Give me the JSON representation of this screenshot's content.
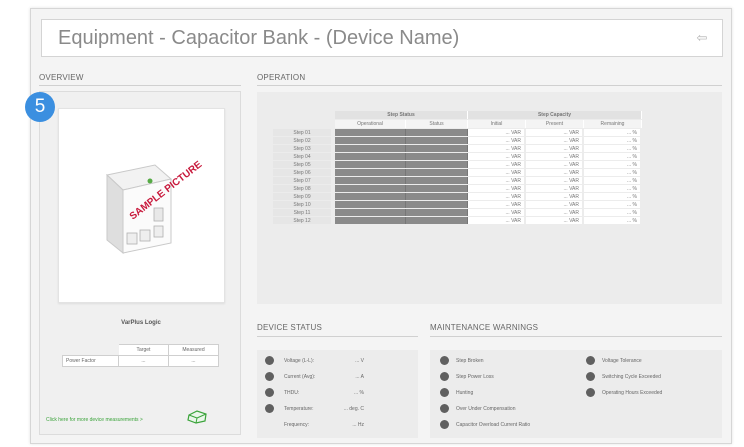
{
  "header": {
    "title": "Equipment - Capacitor Bank - (Device Name)",
    "back_icon": "exit-arrow-icon"
  },
  "badge": "5",
  "overview": {
    "title": "OVERVIEW",
    "picture_watermark": "SAMPLE PICTURE",
    "product_name": "VarPlus Logic",
    "pf_table": {
      "headers": [
        "Target",
        "Measured"
      ],
      "row_label": "Power Factor",
      "values": [
        "...",
        "..."
      ]
    },
    "more_link": "Click here for more device measurements >"
  },
  "operation": {
    "title": "OPERATION",
    "group_headers": [
      "Step Status",
      "Step Capacity"
    ],
    "sub_headers": [
      "Operational",
      "Status",
      "Initial",
      "Present",
      "Remaining"
    ],
    "rows": [
      {
        "label": "Step 01",
        "initial": "... VAR",
        "present": "... VAR",
        "remaining": "... %"
      },
      {
        "label": "Step 02",
        "initial": "... VAR",
        "present": "... VAR",
        "remaining": "... %"
      },
      {
        "label": "Step 03",
        "initial": "... VAR",
        "present": "... VAR",
        "remaining": "... %"
      },
      {
        "label": "Step 04",
        "initial": "... VAR",
        "present": "... VAR",
        "remaining": "... %"
      },
      {
        "label": "Step 05",
        "initial": "... VAR",
        "present": "... VAR",
        "remaining": "... %"
      },
      {
        "label": "Step 06",
        "initial": "... VAR",
        "present": "... VAR",
        "remaining": "... %"
      },
      {
        "label": "Step 07",
        "initial": "... VAR",
        "present": "... VAR",
        "remaining": "... %"
      },
      {
        "label": "Step 08",
        "initial": "... VAR",
        "present": "... VAR",
        "remaining": "... %"
      },
      {
        "label": "Step 09",
        "initial": "... VAR",
        "present": "... VAR",
        "remaining": "... %"
      },
      {
        "label": "Step 10",
        "initial": "... VAR",
        "present": "... VAR",
        "remaining": "... %"
      },
      {
        "label": "Step 11",
        "initial": "... VAR",
        "present": "... VAR",
        "remaining": "... %"
      },
      {
        "label": "Step 12",
        "initial": "... VAR",
        "present": "... VAR",
        "remaining": "... %"
      }
    ]
  },
  "device_status": {
    "title": "DEVICE STATUS",
    "rows": [
      {
        "label": "Voltage (L-L):",
        "value": "... V",
        "has_dot": true
      },
      {
        "label": "Current (Avg):",
        "value": "... A",
        "has_dot": true
      },
      {
        "label": "THDU:",
        "value": "... %",
        "has_dot": true
      },
      {
        "label": "Temperature:",
        "value": "... deg. C",
        "has_dot": true
      },
      {
        "label": "Frequency:",
        "value": "... Hz",
        "has_dot": false
      }
    ]
  },
  "maintenance": {
    "title": "MAINTENANCE WARNINGS",
    "left": [
      "Step Broken",
      "Step Power Loss",
      "Hunting",
      "Over Under Compensation",
      "Capacitor Overload Current Ratio"
    ],
    "right": [
      "Voltage Tolerance",
      "Switching Cycle Exceeded",
      "Operating Hours Exceeded"
    ]
  },
  "colors": {
    "badge": "#3b8fe0",
    "indicator": "#606060",
    "status_cell": "#8a8a8a",
    "link": "#3aa33a"
  }
}
